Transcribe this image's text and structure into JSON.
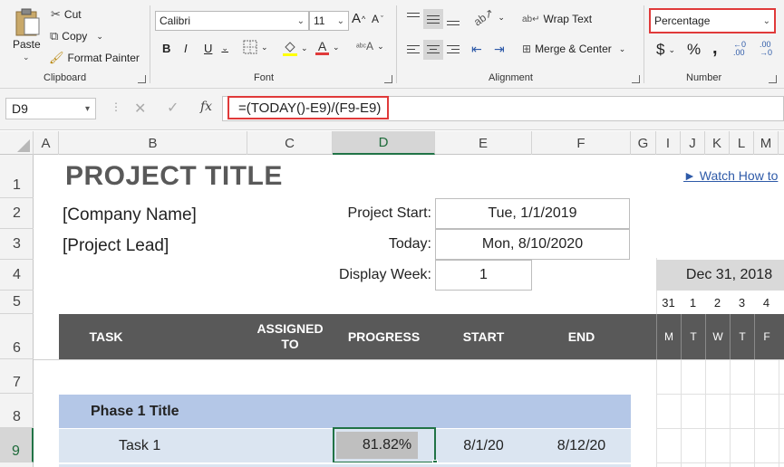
{
  "ribbon": {
    "clipboard": {
      "paste": "Paste",
      "cut": "Cut",
      "copy": "Copy",
      "format_painter": "Format Painter",
      "label": "Clipboard"
    },
    "font": {
      "font_name": "Calibri",
      "font_size": "11",
      "grow": "A",
      "shrink": "A",
      "bold": "B",
      "italic": "I",
      "underline": "U",
      "font_color_letter": "A",
      "label": "Font"
    },
    "alignment": {
      "wrap_text": "Wrap Text",
      "merge_center": "Merge & Center",
      "label": "Alignment"
    },
    "number": {
      "format": "Percentage",
      "currency": "$",
      "percent": "%",
      "comma": ",",
      "label": "Number"
    }
  },
  "formula_bar": {
    "name_box": "D9",
    "fx": "fx",
    "formula": "=(TODAY()-E9)/(F9-E9)"
  },
  "columns": [
    "A",
    "B",
    "C",
    "D",
    "E",
    "F",
    "G",
    "I",
    "J",
    "K",
    "L",
    "M"
  ],
  "rows": [
    "1",
    "2",
    "3",
    "4",
    "5",
    "6",
    "7",
    "8",
    "9"
  ],
  "sheet": {
    "title": "PROJECT TITLE",
    "company": "[Company Name]",
    "lead": "[Project Lead]",
    "project_start_label": "Project Start:",
    "project_start_value": "Tue, 1/1/2019",
    "today_label": "Today:",
    "today_value": "Mon, 8/10/2020",
    "display_week_label": "Display Week:",
    "display_week_value": "1",
    "watch_link": "► Watch How to",
    "week_date": "Dec 31, 2018",
    "day_numbers": [
      "31",
      "1",
      "2",
      "3",
      "4"
    ],
    "day_letters": [
      "M",
      "T",
      "W",
      "T",
      "F"
    ],
    "headers": {
      "task": "TASK",
      "assigned": "ASSIGNED TO",
      "progress": "PROGRESS",
      "start": "START",
      "end": "END"
    },
    "phase1": "Phase 1 Title",
    "task1": {
      "name": "Task 1",
      "progress": "81.82%",
      "start": "8/1/20",
      "end": "8/12/20"
    }
  },
  "colors": {
    "header_band": "#595959",
    "phase_fill": "#b4c7e7",
    "task_fill": "#dbe5f1",
    "highlight": "#e03a3a",
    "excel_green": "#217346",
    "progress_fill": "#bfbfbf"
  }
}
